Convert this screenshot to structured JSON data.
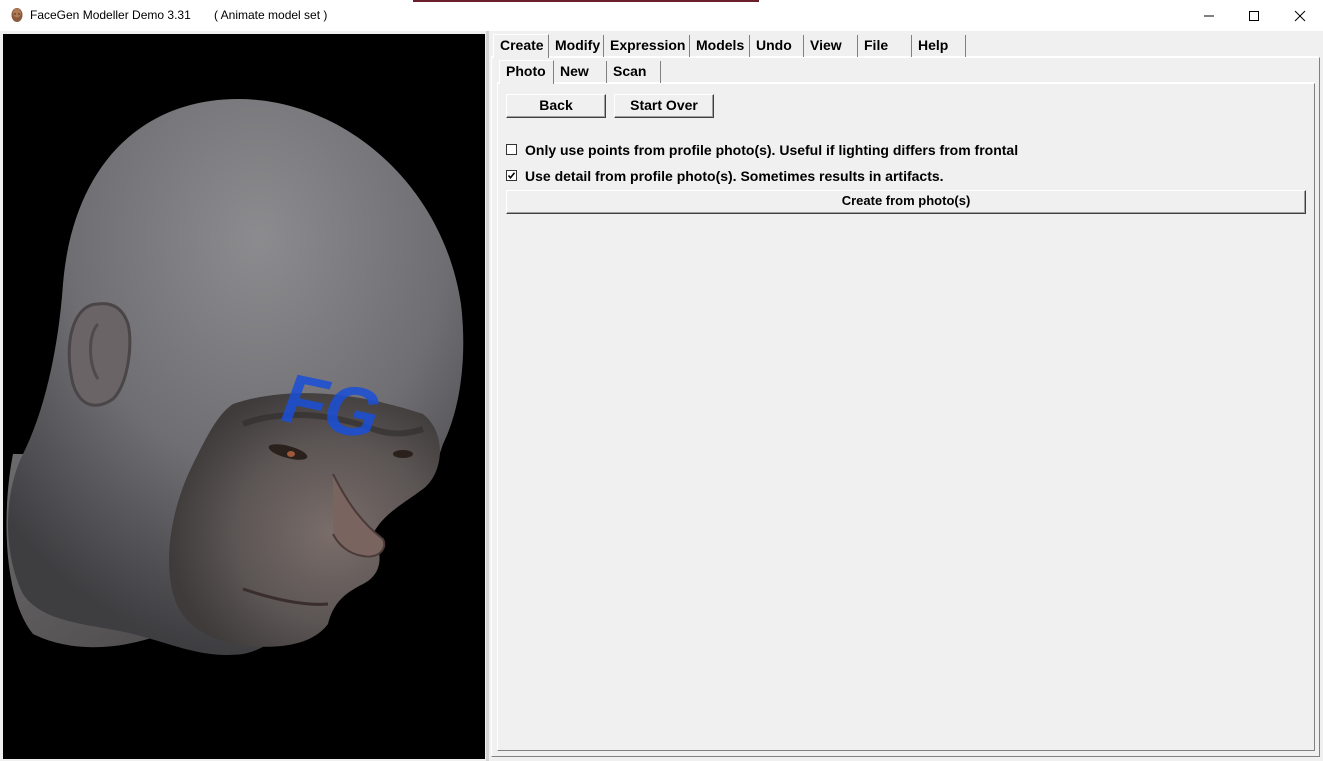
{
  "window": {
    "title": "FaceGen Modeller Demo 3.31",
    "subtitle": "( Animate model set )",
    "controls": [
      "minimize-icon",
      "maximize-icon",
      "close-icon"
    ]
  },
  "viewport": {
    "overlay_text": "FG",
    "overlay_color": "#1a4fd8",
    "background": "#000000"
  },
  "main_tabs": [
    {
      "label": "Create",
      "active": true
    },
    {
      "label": "Modify",
      "active": false
    },
    {
      "label": "Expression",
      "active": false
    },
    {
      "label": "Models",
      "active": false
    },
    {
      "label": "Undo",
      "active": false
    },
    {
      "label": "View",
      "active": false
    },
    {
      "label": "File",
      "active": false
    },
    {
      "label": "Help",
      "active": false
    }
  ],
  "sub_tabs": [
    {
      "label": "Photo",
      "active": true
    },
    {
      "label": "New",
      "active": false
    },
    {
      "label": "Scan",
      "active": false
    }
  ],
  "photo": {
    "back_label": "Back",
    "start_over_label": "Start Over",
    "options": [
      {
        "label": "Only use points from profile photo(s). Useful if lighting differs from frontal",
        "checked": false
      },
      {
        "label": "Use detail from profile photo(s). Sometimes results in artifacts.",
        "checked": true
      }
    ],
    "create_label": "Create from photo(s)"
  }
}
